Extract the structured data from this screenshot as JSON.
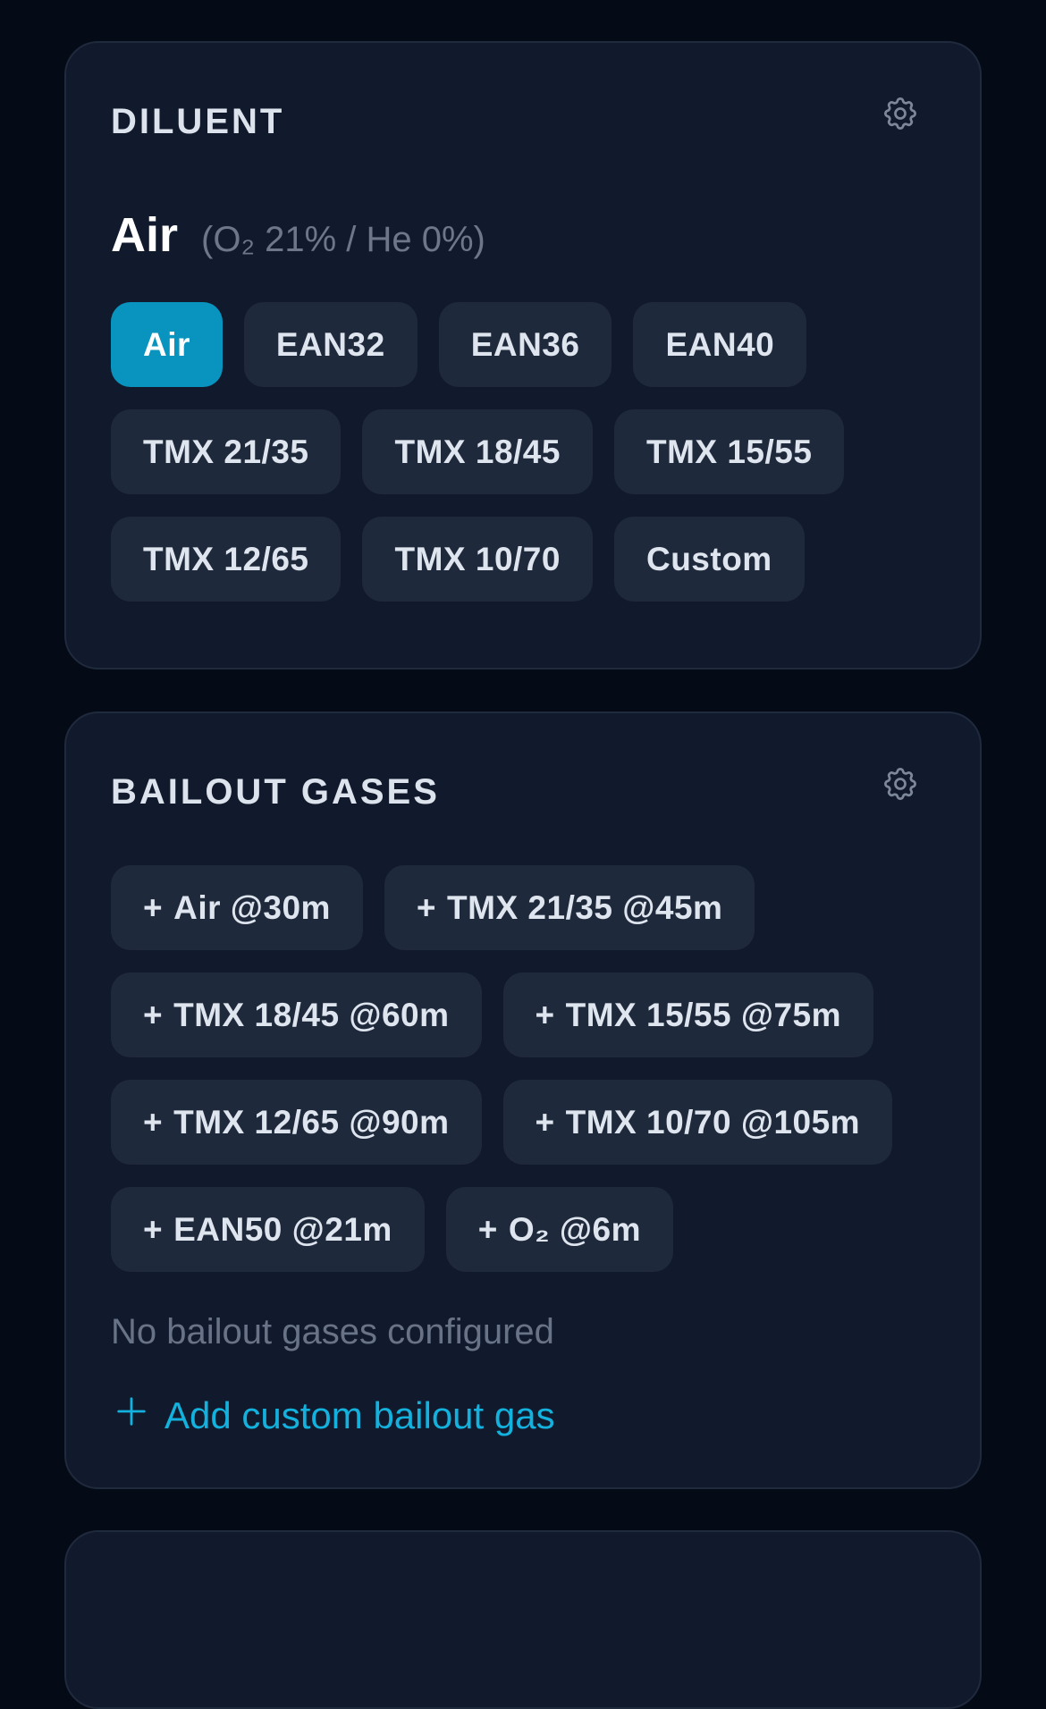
{
  "diluent": {
    "title": "DILUENT",
    "settings_icon": "gear-icon",
    "current": {
      "name": "Air",
      "mix": "(O₂ 21% / He 0%)"
    },
    "options": [
      {
        "label": "Air",
        "active": true
      },
      {
        "label": "EAN32",
        "active": false
      },
      {
        "label": "EAN36",
        "active": false
      },
      {
        "label": "EAN40",
        "active": false
      },
      {
        "label": "TMX 21/35",
        "active": false
      },
      {
        "label": "TMX 18/45",
        "active": false
      },
      {
        "label": "TMX 15/55",
        "active": false
      },
      {
        "label": "TMX 12/65",
        "active": false
      },
      {
        "label": "TMX 10/70",
        "active": false
      },
      {
        "label": "Custom",
        "active": false
      }
    ],
    "colors": {
      "active_chip": "#0994bf",
      "chip": "#1e293b"
    }
  },
  "bailout": {
    "title": "BAILOUT GASES",
    "settings_icon": "gear-icon",
    "presets": [
      {
        "plus": "+",
        "label": "Air @30m"
      },
      {
        "plus": "+",
        "label": "TMX 21/35 @45m"
      },
      {
        "plus": "+",
        "label": "TMX 18/45 @60m"
      },
      {
        "plus": "+",
        "label": "TMX 15/55 @75m"
      },
      {
        "plus": "+",
        "label": "TMX 12/65 @90m"
      },
      {
        "plus": "+",
        "label": "TMX 10/70 @105m"
      },
      {
        "plus": "+",
        "label": "EAN50 @21m"
      },
      {
        "plus": "+",
        "label": "O₂ @6m"
      }
    ],
    "empty_text": "No bailout gases configured",
    "add_label": "Add custom bailout gas",
    "add_icon": "plus-icon",
    "colors": {
      "link": "#13b1dd"
    }
  },
  "colors": {
    "background": "#050a17",
    "card": "#111a2c"
  }
}
